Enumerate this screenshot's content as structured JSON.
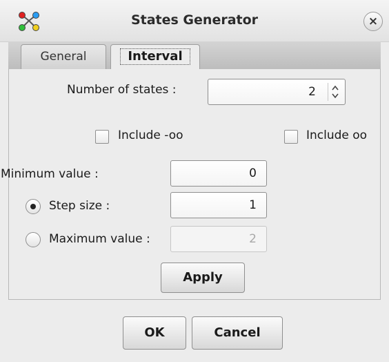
{
  "window": {
    "title": "States Generator",
    "icon": "network-nodes-icon",
    "close_glyph": "×"
  },
  "tabs": [
    {
      "label": "General",
      "selected": false
    },
    {
      "label": "Interval",
      "selected": true
    }
  ],
  "interval": {
    "num_states_label": "Number of states :",
    "num_states_value": "2",
    "include_neg_inf_label": "Include -oo",
    "include_neg_inf_checked": false,
    "include_pos_inf_label": "Include oo",
    "include_pos_inf_checked": false,
    "min_label": "Minimum value :",
    "min_value": "0",
    "step_label": "Step size :",
    "step_value": "1",
    "step_selected": true,
    "max_label": "Maximum value :",
    "max_value": "2",
    "max_selected": false,
    "apply_label": "Apply"
  },
  "footer": {
    "ok_label": "OK",
    "cancel_label": "Cancel"
  }
}
